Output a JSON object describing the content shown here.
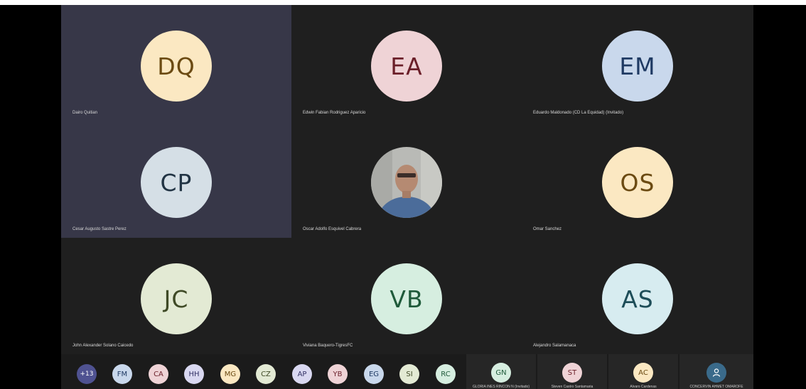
{
  "tiles": [
    {
      "initials": "DQ",
      "name": "Dairo Quitian",
      "bg": "#373748",
      "avatar_bg": "#fbe8c2",
      "avatar_fg": "#6b4a12"
    },
    {
      "initials": "EA",
      "name": "Edwin Fabian Rodriguez Aparicio",
      "bg": "#1f1f1f",
      "avatar_bg": "#efd3d6",
      "avatar_fg": "#6b1f29"
    },
    {
      "initials": "EM",
      "name": "Eduardo Maldonado (CD La Equidad) (Invitado)",
      "bg": "#1f1f1f",
      "avatar_bg": "#c9d8ec",
      "avatar_fg": "#1f3a63"
    },
    {
      "initials": "CP",
      "name": "Cesar Augusto Sastre Perez",
      "bg": "#373748",
      "avatar_bg": "#d5dfe6",
      "avatar_fg": "#223444"
    },
    {
      "initials": "",
      "name": "Oscar Adolfo Esquivel Cabrera",
      "bg": "#1f1f1f",
      "video": true
    },
    {
      "initials": "OS",
      "name": "Omar Sanchez",
      "bg": "#1f1f1f",
      "avatar_bg": "#fbe8c2",
      "avatar_fg": "#6b4a12"
    },
    {
      "initials": "JC",
      "name": "John Alexander Solano Caicedo",
      "bg": "#1f1f1f",
      "avatar_bg": "#e3ead4",
      "avatar_fg": "#3f4a26"
    },
    {
      "initials": "VB",
      "name": "Viviana Baquero-TigresFC",
      "bg": "#1f1f1f",
      "avatar_bg": "#d6eee0",
      "avatar_fg": "#1f5a3a"
    },
    {
      "initials": "AS",
      "name": "Alejandro Salamanaca",
      "bg": "#1f1f1f",
      "avatar_bg": "#d7ecf0",
      "avatar_fg": "#1d4d58"
    }
  ],
  "overflow": {
    "label": "+13",
    "bg": "#4f5291",
    "fg": "#ffffff"
  },
  "chips": [
    {
      "initials": "FM",
      "bg": "#c9d8ec",
      "fg": "#1f3a63"
    },
    {
      "initials": "CA",
      "bg": "#efd3d6",
      "fg": "#6b1f29"
    },
    {
      "initials": "HH",
      "bg": "#d9d8f1",
      "fg": "#333266"
    },
    {
      "initials": "MG",
      "bg": "#fbe8c2",
      "fg": "#6b4a12"
    },
    {
      "initials": "CZ",
      "bg": "#e3ead4",
      "fg": "#3f4a26"
    },
    {
      "initials": "AP",
      "bg": "#d9d8f1",
      "fg": "#333266"
    },
    {
      "initials": "YB",
      "bg": "#efd3d6",
      "fg": "#6b1f29"
    },
    {
      "initials": "EG",
      "bg": "#c9d8ec",
      "fg": "#1f3a63"
    },
    {
      "initials": "SI",
      "bg": "#e3ead4",
      "fg": "#3f4a26"
    },
    {
      "initials": "RC",
      "bg": "#d6eee0",
      "fg": "#1f5a3a"
    }
  ],
  "mini_tiles": [
    {
      "initials": "GN",
      "name": "GLORIA INES RINCON N (Invitado)",
      "bg": "#d6eee0",
      "fg": "#1f5a3a"
    },
    {
      "initials": "ST",
      "name": "Steven Castro Santamaria",
      "bg": "#efd3d6",
      "fg": "#6b1f29"
    },
    {
      "initials": "AC",
      "name": "Alvaro Cardenas",
      "bg": "#fbe8c2",
      "fg": "#6b4a12"
    },
    {
      "initials": "",
      "name": "CONCERVIN AHMET OMAROFE",
      "bg": "#3a6a8a",
      "fg": "#ffffff",
      "person_icon": true
    }
  ]
}
